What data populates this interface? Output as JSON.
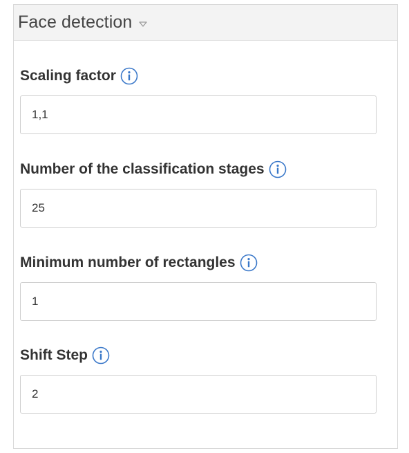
{
  "panel": {
    "title": "Face detection",
    "toggle_icon": "caret-down-icon"
  },
  "fields": [
    {
      "label": "Scaling factor",
      "value": "1,1",
      "info_icon": "info-icon"
    },
    {
      "label": "Number of the classification stages",
      "value": "25",
      "info_icon": "info-icon"
    },
    {
      "label": "Minimum number of rectangles",
      "value": "1",
      "info_icon": "info-icon"
    },
    {
      "label": "Shift Step",
      "value": "2",
      "info_icon": "info-icon"
    }
  ],
  "colors": {
    "accent": "#3a78c9",
    "header_bg": "#f3f3f3",
    "border": "#cfcfcf"
  }
}
